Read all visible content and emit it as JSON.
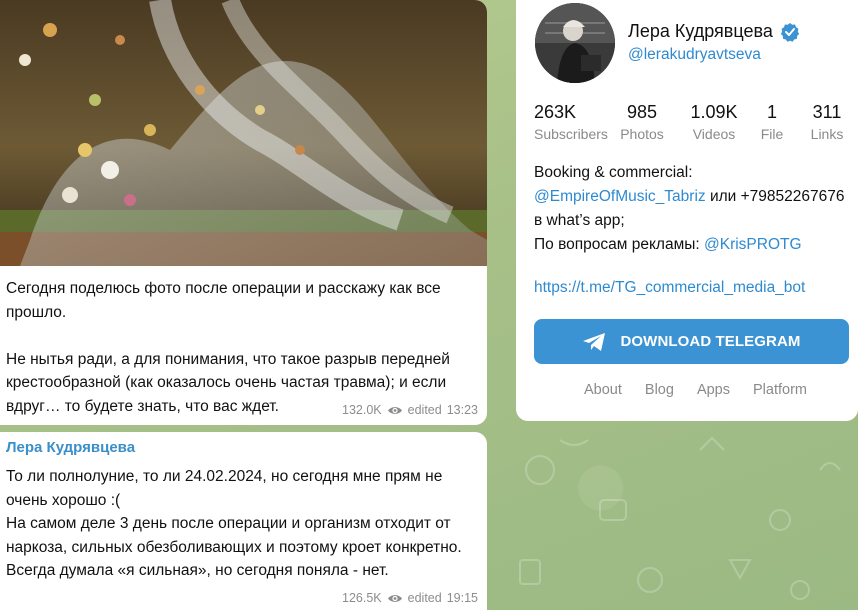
{
  "feed": {
    "post1": {
      "text": "Сегодня поделюсь фото после операции и расскажу как все прошло.\n\nНе нытья ради, а для понимания, что такое разрыв передней крестообразной (как оказалось очень частая травма); и если вдруг… то будете знать, что вас ждет.",
      "views": "132.0K",
      "edited": "edited",
      "time": "13:23"
    },
    "post2": {
      "author": "Лера Кудрявцева",
      "text": "То ли полнолуние, то ли 24.02.2024, но сегодня мне прям не очень хорошо :(\nНа самом деле 3 день после операции и организм отходит от наркоза, сильных обезболивающих и поэтому кроет конкретно. Всегда думала «я сильная», но сегодня поняла - нет.",
      "views": "126.5K",
      "edited": "edited",
      "time": "19:15"
    }
  },
  "channel": {
    "title": "Лера Кудрявцева",
    "handle": "@lerakudryavtseva",
    "stats": [
      {
        "value": "263K",
        "label": "Subscribers"
      },
      {
        "value": "985",
        "label": "Photos"
      },
      {
        "value": "1.09K",
        "label": "Videos"
      },
      {
        "value": "1",
        "label": "File"
      },
      {
        "value": "311",
        "label": "Links"
      }
    ],
    "description": {
      "line1": "Booking & commercial:",
      "link1": "@EmpireOfMusic_Tabriz",
      "line2_rest": " или +79852267676",
      "line3": "в what’s app;",
      "line4_prefix": "По вопросам рекламы: ",
      "link2": "@KrisPROTG"
    },
    "url": "https://t.me/TG_commercial_media_bot",
    "download_label": "DOWNLOAD TELEGRAM",
    "footer": [
      "About",
      "Blog",
      "Apps",
      "Platform"
    ]
  },
  "colors": {
    "accent": "#3b93d3",
    "link": "#2e8ad0",
    "author": "#3a8fc9",
    "background": "#a9c28a"
  },
  "icons": [
    "eye-icon",
    "verified-icon",
    "telegram-plane-icon"
  ]
}
